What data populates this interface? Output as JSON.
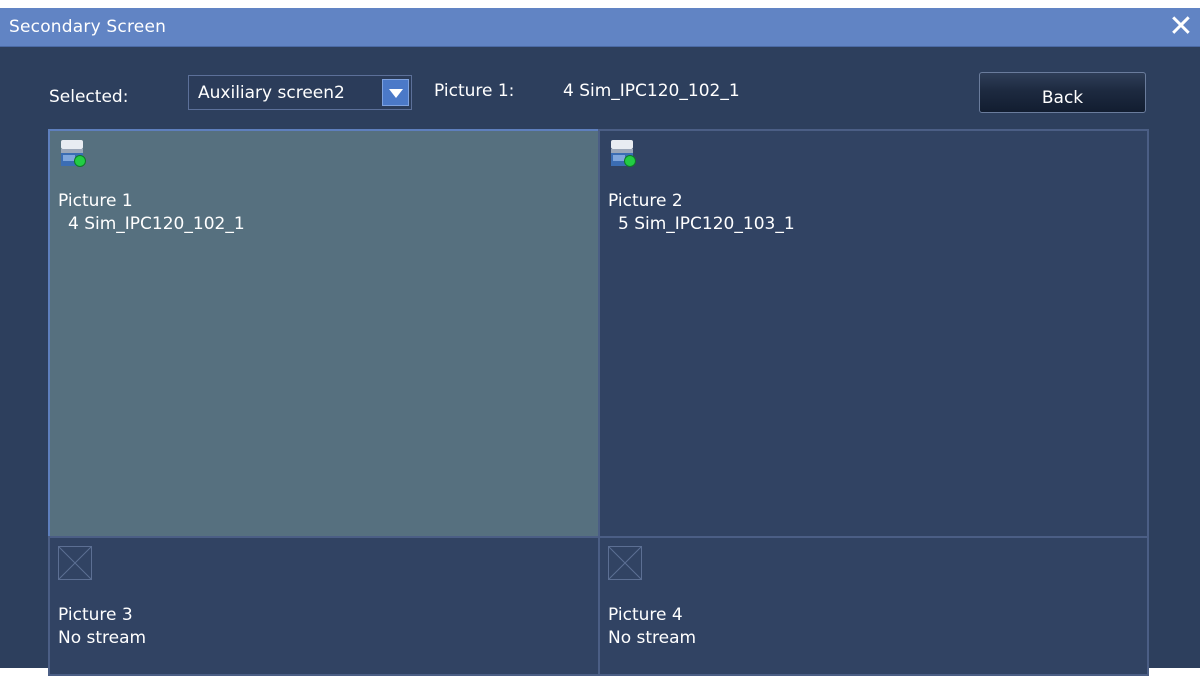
{
  "window": {
    "title": "Secondary Screen",
    "close_icon": "close-icon"
  },
  "toolbar": {
    "selected_label": "Selected:",
    "screen_select": {
      "value": "Auxiliary screen2",
      "icon": "chevron-down-icon"
    },
    "current_picture_label": "Picture 1:",
    "current_picture_value": "4 Sim_IPC120_102_1",
    "back_label": "Back"
  },
  "pictures": [
    {
      "name": "Picture 1",
      "stream": "4 Sim_IPC120_102_1",
      "icon": "camera-online-icon",
      "selected": true
    },
    {
      "name": "Picture 2",
      "stream": "5 Sim_IPC120_103_1",
      "icon": "camera-online-icon",
      "selected": false
    },
    {
      "name": "Picture 3",
      "stream": "No stream",
      "icon": "no-stream-placeholder-icon",
      "selected": false
    },
    {
      "name": "Picture 4",
      "stream": "No stream",
      "icon": "no-stream-placeholder-icon",
      "selected": false
    }
  ],
  "colors": {
    "titlebar": "#6184c4",
    "background": "#2d3f5d",
    "selected_cell": "#56707f",
    "online_indicator": "#22cc44"
  }
}
